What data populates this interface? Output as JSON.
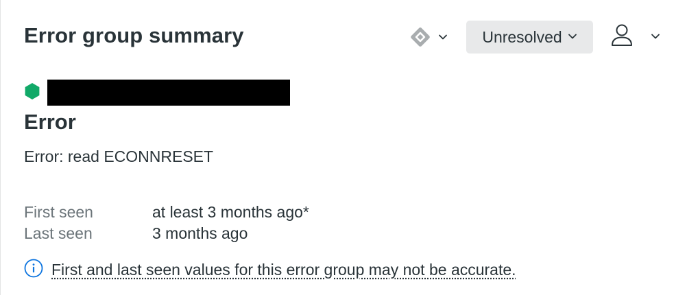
{
  "header": {
    "title": "Error group summary",
    "status_dropdown": {
      "label": "Unresolved"
    }
  },
  "error": {
    "entity_status_color": "#11a968",
    "title": "Error",
    "message": "Error: read ECONNRESET"
  },
  "seen": {
    "first_label": "First seen",
    "first_value": "at least 3 months ago*",
    "last_label": "Last seen",
    "last_value": "3 months ago"
  },
  "notice": {
    "text": "First and last seen values for this error group may not be accurate.",
    "icon": "info-icon",
    "accent_color": "#0c74df"
  },
  "icons": {
    "issue_tracker": "jira-diamond-icon",
    "assignee": "user-icon",
    "dropdown": "chevron-down-icon",
    "entity_status": "hexagon-status-icon"
  }
}
